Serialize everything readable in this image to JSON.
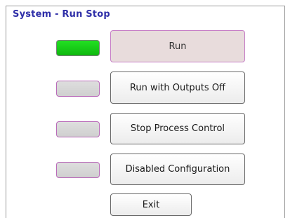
{
  "window": {
    "title": "System - Run Stop"
  },
  "controls": [
    {
      "label": "Run",
      "indicator_state": "on",
      "indicator_color": "#16c916",
      "selected": true
    },
    {
      "label": "Run with Outputs Off",
      "indicator_state": "off",
      "indicator_color": "#d6d6d6",
      "selected": false
    },
    {
      "label": "Stop Process Control",
      "indicator_state": "off",
      "indicator_color": "#d6d6d6",
      "selected": false
    },
    {
      "label": "Disabled Configuration",
      "indicator_state": "off",
      "indicator_color": "#d6d6d6",
      "selected": false
    }
  ],
  "exit_button": {
    "label": "Exit"
  },
  "colors": {
    "title": "#2f2fa8",
    "selected_button_fill": "#e8dcdc",
    "selected_button_border": "#c77fc7"
  }
}
